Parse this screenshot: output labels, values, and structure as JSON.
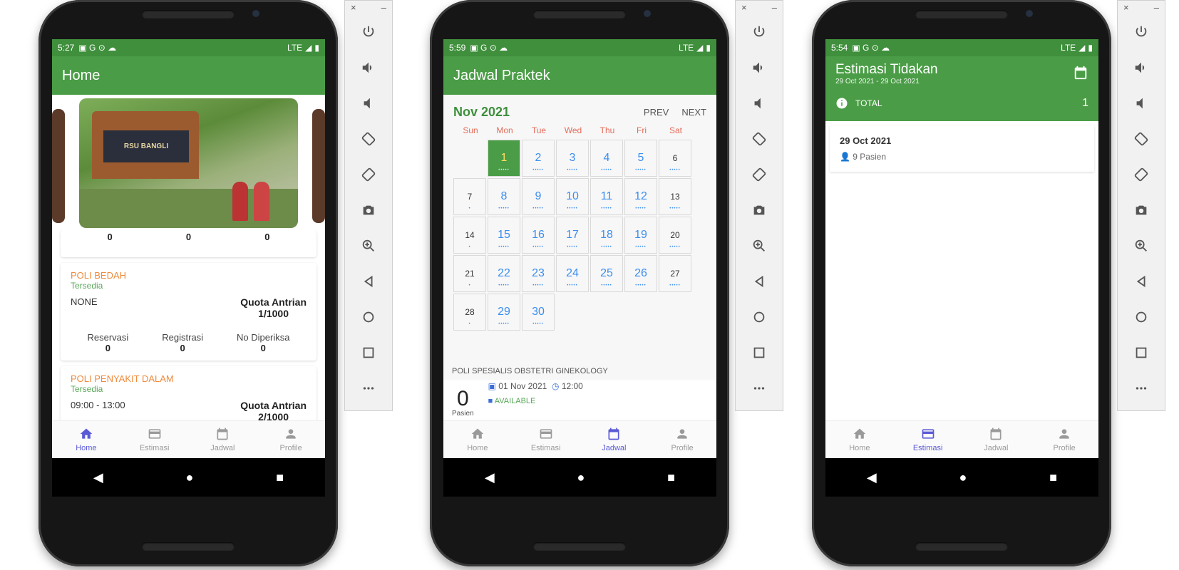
{
  "toolbar": {
    "close": "×",
    "minimize": "–"
  },
  "sysnav": {
    "back": "◀",
    "home": "●",
    "recents": "■"
  },
  "nav": {
    "home": "Home",
    "estimasi": "Estimasi",
    "jadwal": "Jadwal",
    "profile": "Profile"
  },
  "phone1": {
    "time": "5:27",
    "status_right": "LTE",
    "appbar_title": "Home",
    "image_sign": "RSU BANGLI",
    "prev_stats": [
      "0",
      "0",
      "0"
    ],
    "cards": [
      {
        "name": "POLI BEDAH",
        "status": "Tersedia",
        "hours": "NONE",
        "quota_label": "Quota Antrian",
        "quota_value": "1/1000",
        "stats": [
          {
            "label": "Reservasi",
            "value": "0"
          },
          {
            "label": "Registrasi",
            "value": "0"
          },
          {
            "label": "No Diperiksa",
            "value": "0"
          }
        ]
      },
      {
        "name": "POLI PENYAKIT DALAM",
        "status": "Tersedia",
        "hours": "09:00 - 13:00",
        "quota_label": "Quota Antrian",
        "quota_value": "2/1000"
      }
    ]
  },
  "phone2": {
    "time": "5:59",
    "status_right": "LTE",
    "appbar_title": "Jadwal Praktek",
    "month": "Nov 2021",
    "prev": "PREV",
    "next": "NEXT",
    "dow": [
      "Sun",
      "Mon",
      "Tue",
      "Wed",
      "Thu",
      "Fri",
      "Sat"
    ],
    "days": [
      "",
      "1",
      "2",
      "3",
      "4",
      "5",
      "6",
      "7",
      "8",
      "9",
      "10",
      "11",
      "12",
      "13",
      "14",
      "15",
      "16",
      "17",
      "18",
      "19",
      "20",
      "21",
      "22",
      "23",
      "24",
      "25",
      "26",
      "27",
      "28",
      "29",
      "30"
    ],
    "dots_full": "•••••",
    "dots_single": "•",
    "schedule": {
      "poli": "POLI SPESIALIS OBSTETRI GINEKOLOGY",
      "count": "0",
      "count_label": "Pasien",
      "date": "01 Nov 2021",
      "time": "12:00",
      "status": "AVAILABLE"
    }
  },
  "phone3": {
    "time": "5:54",
    "status_right": "LTE",
    "appbar_title": "Estimasi Tidakan",
    "date_range": "29 Oct 2021 - 29 Oct 2021",
    "total_label": "TOTAL",
    "total_value": "1",
    "item_date": "29 Oct 2021",
    "item_pasien": "9 Pasien"
  }
}
